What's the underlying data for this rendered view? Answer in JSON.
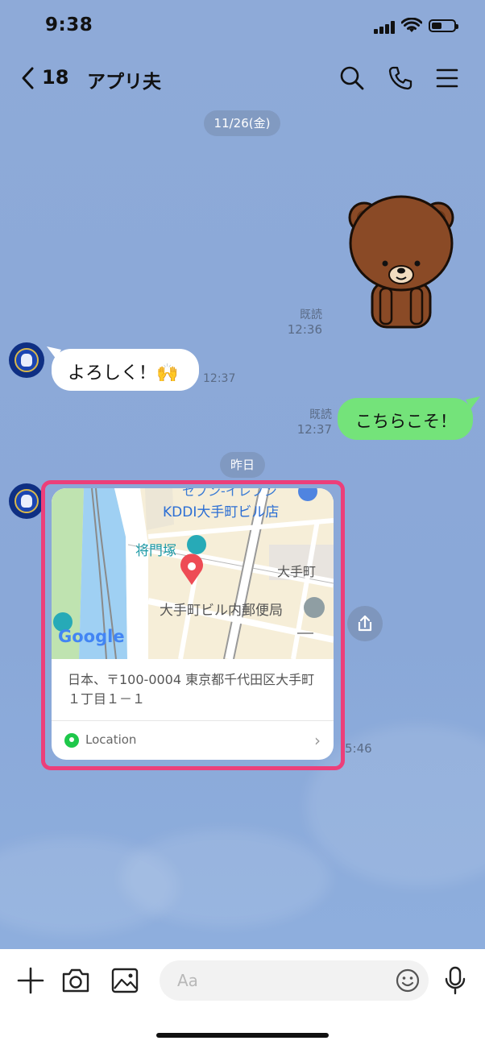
{
  "status_bar": {
    "time": "9:38"
  },
  "header": {
    "unread_count": "18",
    "title": "アプリ夫",
    "icons": [
      "chevron-left-icon",
      "search-icon",
      "phone-icon",
      "menu-icon"
    ]
  },
  "messages": {
    "date_1": "11/26(金)",
    "sticker_read": "既読",
    "sticker_time": "12:36",
    "incoming_1_text": "よろしく！🙌",
    "incoming_1_time": "12:37",
    "outgoing_1_read": "既読",
    "outgoing_1_time": "12:37",
    "outgoing_1_text": "こちらこそ！",
    "date_2": "昨日",
    "location_time": "5:46"
  },
  "location_card": {
    "address": "日本、〒100-0004 東京都千代田区大手町１丁目１－１",
    "footer_label": "Location",
    "map_labels": {
      "place_1": "KDDI大手町ビル店",
      "place_1_cut": "セブン-イレブン",
      "place_2": "将門塚",
      "place_3": "大手町",
      "place_4": "大手町ビル内郵便局",
      "brand": "Google"
    }
  },
  "input_bar": {
    "placeholder": "Aa",
    "icons": [
      "plus-icon",
      "camera-icon",
      "image-icon",
      "emoji-icon",
      "mic-icon"
    ]
  },
  "colors": {
    "background": "#8eaad8",
    "outgoing_bubble": "#74e37a",
    "highlight": "#ec3f7a",
    "pin": "#ee4b55"
  }
}
